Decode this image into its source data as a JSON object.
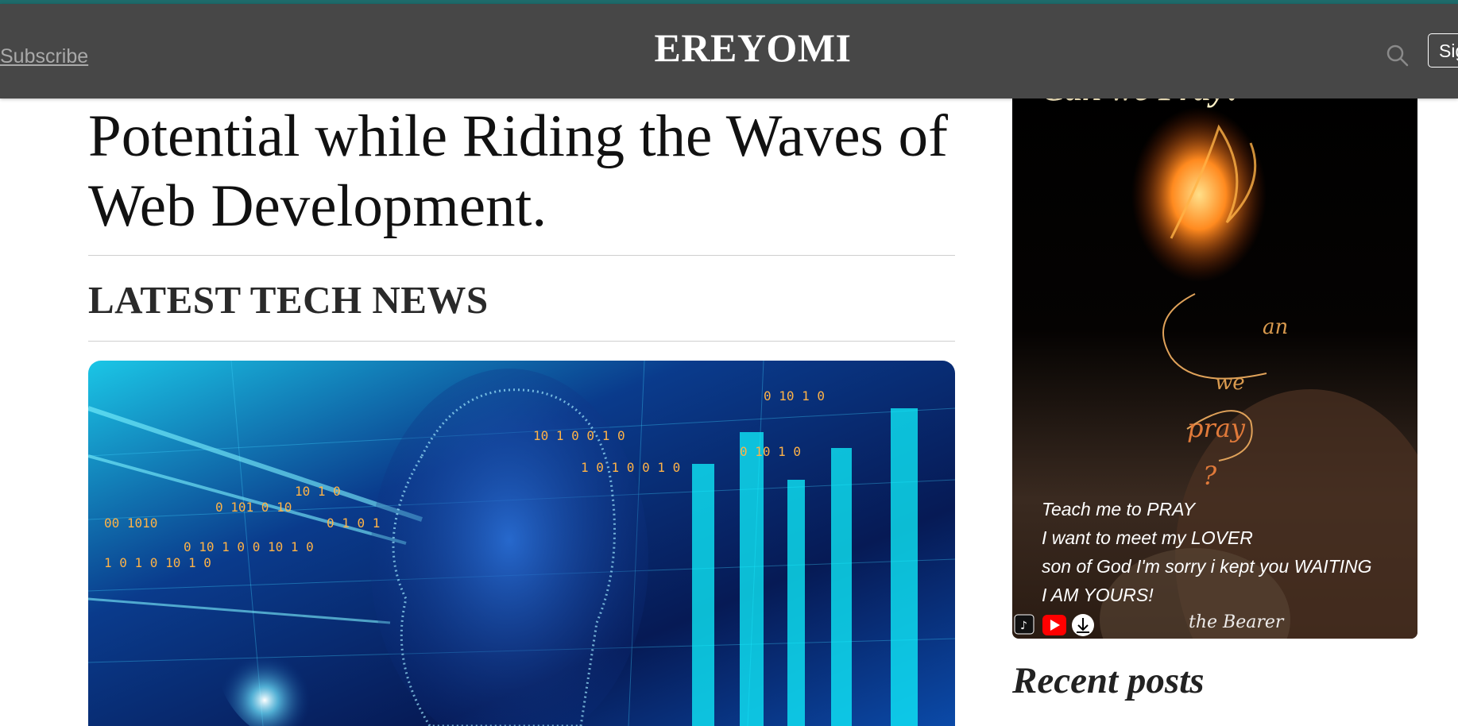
{
  "header": {
    "subscribe_label": "Subscribe",
    "site_title": "EREYOMI",
    "signin_label": "Sign in",
    "search_icon": "search-icon"
  },
  "post": {
    "title": "Potential while Riding the Waves of Web Development."
  },
  "section": {
    "heading": "LATEST TECH NEWS"
  },
  "sidebar": {
    "ad": {
      "headline": "Can we Pray!",
      "script_text": "Can we pray ?",
      "lines": [
        "Teach me to PRAY",
        "I want to meet my LOVER",
        "son of God I'm sorry i kept you WAITING",
        "I AM YOURS!"
      ],
      "icons": [
        "tiktok-icon",
        "youtube-icon",
        "download-icon"
      ]
    },
    "recent_heading": "Recent posts"
  },
  "colors": {
    "header_bg": "#474747",
    "top_accent": "#1e6b6b"
  }
}
